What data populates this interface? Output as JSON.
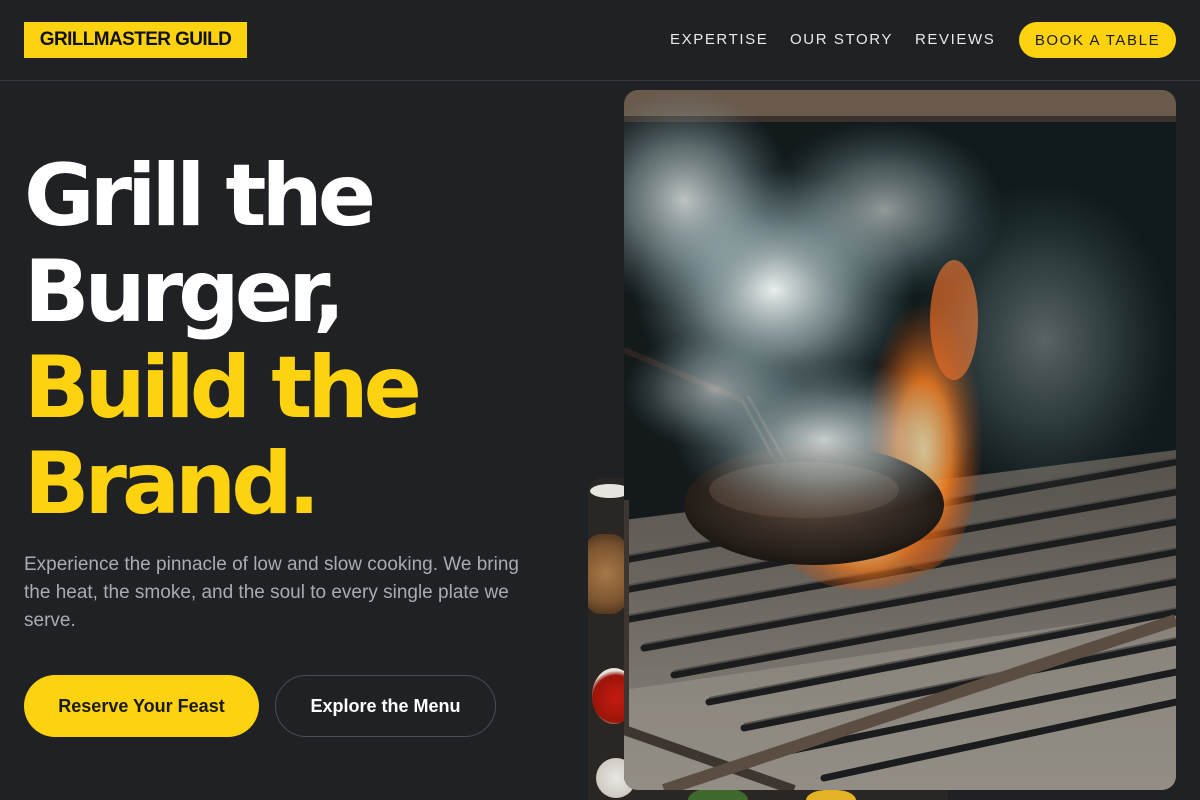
{
  "header": {
    "logo": "GRILLMASTER GUILD",
    "nav": [
      "EXPERTISE",
      "OUR STORY",
      "REVIEWS"
    ],
    "cta": "BOOK A TABLE"
  },
  "hero": {
    "headline_line1": "Grill the",
    "headline_line2": "Burger,",
    "headline_line3": "Build the",
    "headline_line4": "Brand.",
    "lead": "Experience the pinnacle of low and slow cooking. We bring the heat, the smoke, and the soul to every single plate we serve.",
    "primary_button": "Reserve Your Feast",
    "secondary_button": "Explore the Menu"
  },
  "colors": {
    "background": "#1f2124",
    "accent": "#fdd20f",
    "muted_text": "#a8acb3"
  },
  "images": {
    "main": "burger-patty-on-flaming-grill-photo",
    "secondary": "spices-and-sauces-table-photo"
  }
}
